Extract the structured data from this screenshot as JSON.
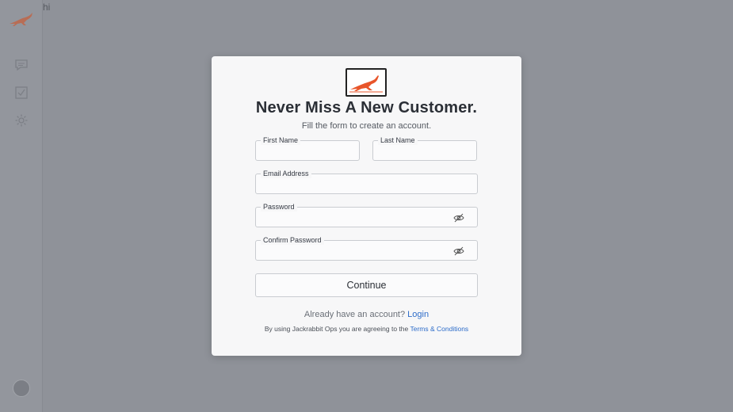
{
  "app": {
    "greeting": "hi"
  },
  "sidebar": {
    "icons": [
      "logo-icon",
      "chat-icon",
      "checklist-icon",
      "gear-icon",
      "avatar"
    ]
  },
  "modal": {
    "title": "Never Miss A New Customer.",
    "subtitle": "Fill the form to create an account.",
    "fields": {
      "first_name": {
        "label": "First Name",
        "value": ""
      },
      "last_name": {
        "label": "Last Name",
        "value": ""
      },
      "email": {
        "label": "Email Address",
        "value": ""
      },
      "password": {
        "label": "Password",
        "value": ""
      },
      "confirm_password": {
        "label": "Confirm Password",
        "value": ""
      }
    },
    "continue_label": "Continue",
    "login_prompt": "Already have an account?",
    "login_link": "Login",
    "terms_prefix": "By using Jackrabbit Ops you are agreeing to the",
    "terms_link": "Terms & Conditions"
  },
  "colors": {
    "accent": "#e8552a",
    "link": "#2d6cc9",
    "backdrop": "#8f9299"
  }
}
